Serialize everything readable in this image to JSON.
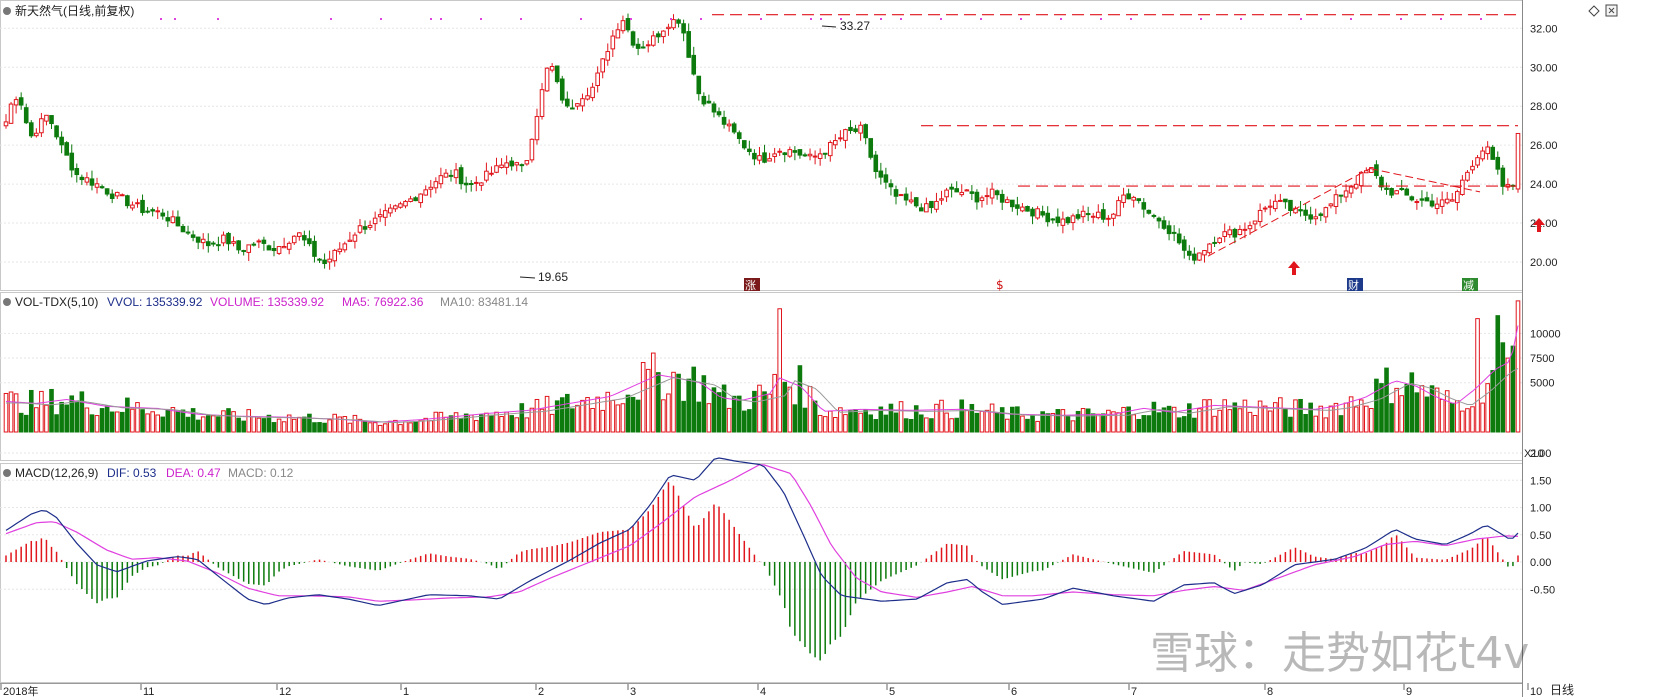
{
  "header": {
    "main_title": "新天然气(日线,前复权)",
    "vol_title": "VOL-TDX(5,10)",
    "vol_vvol": "VVOL: 135339.92",
    "vol_volume": "VOLUME: 135339.92",
    "vol_ma5": "MA5: 76922.36",
    "vol_ma10": "MA10: 83481.14",
    "macd_title": "MACD(12,26,9)",
    "macd_dif": "DIF: 0.53",
    "macd_dea": "DEA: 0.47",
    "macd_macd": "MACD: 0.12"
  },
  "markers": {
    "high_label": "33.27",
    "low_label": "19.65",
    "event_1": "涨",
    "event_2": "$",
    "event_3": "财",
    "event_4": "减"
  },
  "x_axis": {
    "months": [
      "2018年",
      "11",
      "12",
      "1",
      "2",
      "3",
      "4",
      "5",
      "6",
      "7",
      "8",
      "9",
      "10"
    ],
    "period_label": "日线"
  },
  "watermark": "雪球：走势如花t4v",
  "vol_unit": "X10",
  "colors": {
    "up": "#e0161c",
    "down": "#0c7a0c",
    "ma_pink": "#e040e0",
    "ma_gray": "#999999",
    "dif": "#1d2e8a",
    "dea": "#e040e0",
    "support_line": "#e0161c"
  },
  "chart_data": [
    {
      "type": "candlestick",
      "title": "新天然气(日线,前复权)",
      "y_ticks": [
        20.0,
        22.0,
        24.0,
        26.0,
        28.0,
        30.0,
        32.0
      ],
      "ylim": [
        19.0,
        33.7
      ],
      "x_months": [
        "2018年",
        "11",
        "12",
        "1",
        "2",
        "3",
        "4",
        "5",
        "6",
        "7",
        "8",
        "9",
        "10"
      ],
      "annotations": [
        {
          "label": "33.27",
          "value": 33.27
        },
        {
          "label": "19.65",
          "value": 19.65
        }
      ],
      "horizontal_lines": [
        32.7,
        27.0,
        23.9
      ],
      "anchors": [
        [
          0,
          27.2
        ],
        [
          8,
          28.6
        ],
        [
          14,
          28.4
        ],
        [
          24,
          26.4
        ],
        [
          40,
          27.5
        ],
        [
          46,
          27.1
        ],
        [
          55,
          25.9
        ],
        [
          70,
          24.5
        ],
        [
          90,
          24.0
        ],
        [
          105,
          23.5
        ],
        [
          120,
          23.1
        ],
        [
          135,
          22.7
        ],
        [
          155,
          22.5
        ],
        [
          178,
          21.6
        ],
        [
          200,
          20.9
        ],
        [
          218,
          21.2
        ],
        [
          232,
          20.6
        ],
        [
          248,
          21.0
        ],
        [
          268,
          20.7
        ],
        [
          290,
          21.5
        ],
        [
          306,
          20.4
        ],
        [
          316,
          19.9
        ],
        [
          330,
          20.6
        ],
        [
          350,
          21.7
        ],
        [
          370,
          22.2
        ],
        [
          390,
          22.8
        ],
        [
          410,
          23.5
        ],
        [
          430,
          24.3
        ],
        [
          445,
          24.6
        ],
        [
          460,
          23.9
        ],
        [
          480,
          24.5
        ],
        [
          500,
          25.2
        ],
        [
          515,
          24.7
        ],
        [
          520,
          26.0
        ],
        [
          530,
          28.2
        ],
        [
          540,
          30.4
        ],
        [
          548,
          29.0
        ],
        [
          558,
          27.8
        ],
        [
          570,
          28.5
        ],
        [
          584,
          29.0
        ],
        [
          600,
          31.3
        ],
        [
          612,
          32.6
        ],
        [
          626,
          31.0
        ],
        [
          640,
          31.3
        ],
        [
          658,
          32.3
        ],
        [
          670,
          32.5
        ],
        [
          680,
          30.3
        ],
        [
          688,
          28.7
        ],
        [
          702,
          27.8
        ],
        [
          716,
          27.0
        ],
        [
          733,
          26.0
        ],
        [
          750,
          25.2
        ],
        [
          766,
          25.8
        ],
        [
          782,
          25.7
        ],
        [
          800,
          25.3
        ],
        [
          818,
          25.9
        ],
        [
          834,
          26.6
        ],
        [
          850,
          26.8
        ],
        [
          865,
          24.5
        ],
        [
          885,
          23.3
        ],
        [
          905,
          22.9
        ],
        [
          918,
          22.7
        ],
        [
          935,
          23.6
        ],
        [
          950,
          23.6
        ],
        [
          965,
          23.3
        ],
        [
          980,
          23.5
        ],
        [
          995,
          23.1
        ],
        [
          1015,
          22.7
        ],
        [
          1035,
          22.3
        ],
        [
          1052,
          22.1
        ],
        [
          1068,
          22.4
        ],
        [
          1084,
          22.4
        ],
        [
          1098,
          22.3
        ],
        [
          1110,
          23.4
        ],
        [
          1120,
          23.5
        ],
        [
          1134,
          22.6
        ],
        [
          1148,
          22.1
        ],
        [
          1162,
          21.3
        ],
        [
          1176,
          20.1
        ],
        [
          1190,
          20.7
        ],
        [
          1204,
          21.4
        ],
        [
          1220,
          21.5
        ],
        [
          1235,
          21.9
        ],
        [
          1247,
          22.6
        ],
        [
          1258,
          23.1
        ],
        [
          1270,
          22.9
        ],
        [
          1282,
          22.5
        ],
        [
          1298,
          22.4
        ],
        [
          1312,
          22.7
        ],
        [
          1326,
          23.5
        ],
        [
          1340,
          24.1
        ],
        [
          1355,
          24.8
        ],
        [
          1370,
          23.7
        ],
        [
          1386,
          23.5
        ],
        [
          1400,
          23.2
        ],
        [
          1412,
          23.1
        ],
        [
          1425,
          23.0
        ],
        [
          1438,
          23.2
        ],
        [
          1450,
          24.5
        ],
        [
          1461,
          25.5
        ],
        [
          1470,
          25.9
        ],
        [
          1480,
          24.8
        ],
        [
          1487,
          23.9
        ],
        [
          1492,
          23.8
        ],
        [
          1500,
          24.0
        ],
        [
          1502,
          26.6
        ]
      ]
    },
    {
      "type": "bar",
      "title": "VOL-TDX(5,10)",
      "y_ticks": [
        5000,
        7500,
        10000
      ],
      "ylim": [
        0,
        14000
      ],
      "unit": "X10",
      "series": [
        {
          "name": "MA5",
          "values_note": "moving average of volume"
        },
        {
          "name": "MA10",
          "values_note": "moving average of volume"
        }
      ],
      "anchors": [
        [
          0,
          3100
        ],
        [
          30,
          2900
        ],
        [
          60,
          3300
        ],
        [
          100,
          2600
        ],
        [
          150,
          2400
        ],
        [
          190,
          1800
        ],
        [
          230,
          1600
        ],
        [
          280,
          1500
        ],
        [
          330,
          1300
        ],
        [
          370,
          1000
        ],
        [
          405,
          1200
        ],
        [
          440,
          1500
        ],
        [
          480,
          1900
        ],
        [
          520,
          2200
        ],
        [
          560,
          2900
        ],
        [
          600,
          3600
        ],
        [
          635,
          5200
        ],
        [
          648,
          5800
        ],
        [
          665,
          5500
        ],
        [
          690,
          5000
        ],
        [
          710,
          3500
        ],
        [
          730,
          3200
        ],
        [
          760,
          3900
        ],
        [
          768,
          5500
        ],
        [
          790,
          4600
        ],
        [
          812,
          2100
        ],
        [
          850,
          2300
        ],
        [
          900,
          2200
        ],
        [
          950,
          2300
        ],
        [
          1000,
          1800
        ],
        [
          1050,
          1700
        ],
        [
          1100,
          1800
        ],
        [
          1130,
          2400
        ],
        [
          1160,
          2000
        ],
        [
          1200,
          2700
        ],
        [
          1250,
          2500
        ],
        [
          1300,
          2300
        ],
        [
          1320,
          2600
        ],
        [
          1350,
          3500
        ],
        [
          1380,
          5200
        ],
        [
          1400,
          4700
        ],
        [
          1420,
          3600
        ],
        [
          1440,
          2800
        ],
        [
          1460,
          4400
        ],
        [
          1480,
          6400
        ],
        [
          1495,
          7200
        ],
        [
          1502,
          10800
        ]
      ]
    },
    {
      "type": "line",
      "title": "MACD(12,26,9)",
      "y_ticks": [
        -0.5,
        0.0,
        0.5,
        1.0,
        1.5,
        2.0
      ],
      "ylim": [
        -0.95,
        2.25
      ],
      "series": [
        {
          "name": "DIF",
          "anchors": [
            [
              0,
              0.58
            ],
            [
              25,
              0.88
            ],
            [
              38,
              0.96
            ],
            [
              50,
              0.82
            ],
            [
              70,
              0.35
            ],
            [
              90,
              -0.05
            ],
            [
              110,
              -0.18
            ],
            [
              140,
              0.02
            ],
            [
              170,
              0.1
            ],
            [
              190,
              0.05
            ],
            [
              215,
              -0.32
            ],
            [
              240,
              -0.68
            ],
            [
              258,
              -0.78
            ],
            [
              280,
              -0.66
            ],
            [
              310,
              -0.6
            ],
            [
              340,
              -0.68
            ],
            [
              370,
              -0.8
            ],
            [
              390,
              -0.72
            ],
            [
              420,
              -0.6
            ],
            [
              460,
              -0.62
            ],
            [
              490,
              -0.68
            ],
            [
              520,
              -0.35
            ],
            [
              560,
              0.03
            ],
            [
              590,
              0.35
            ],
            [
              620,
              0.6
            ],
            [
              640,
              1.05
            ],
            [
              660,
              1.6
            ],
            [
              685,
              1.5
            ],
            [
              705,
              1.92
            ],
            [
              725,
              1.85
            ],
            [
              752,
              1.78
            ],
            [
              772,
              1.3
            ],
            [
              792,
              0.5
            ],
            [
              810,
              -0.25
            ],
            [
              830,
              -0.62
            ],
            [
              870,
              -0.72
            ],
            [
              905,
              -0.68
            ],
            [
              935,
              -0.38
            ],
            [
              955,
              -0.32
            ],
            [
              970,
              -0.55
            ],
            [
              990,
              -0.78
            ],
            [
              1030,
              -0.68
            ],
            [
              1060,
              -0.48
            ],
            [
              1100,
              -0.62
            ],
            [
              1140,
              -0.72
            ],
            [
              1170,
              -0.42
            ],
            [
              1200,
              -0.38
            ],
            [
              1220,
              -0.58
            ],
            [
              1248,
              -0.42
            ],
            [
              1280,
              -0.05
            ],
            [
              1320,
              0.05
            ],
            [
              1350,
              0.25
            ],
            [
              1380,
              0.6
            ],
            [
              1400,
              0.42
            ],
            [
              1430,
              0.32
            ],
            [
              1455,
              0.52
            ],
            [
              1470,
              0.68
            ],
            [
              1485,
              0.52
            ],
            [
              1495,
              0.4
            ],
            [
              1502,
              0.53
            ]
          ]
        },
        {
          "name": "DEA",
          "anchors": [
            [
              0,
              0.52
            ],
            [
              30,
              0.72
            ],
            [
              48,
              0.74
            ],
            [
              70,
              0.55
            ],
            [
              100,
              0.22
            ],
            [
              125,
              0.05
            ],
            [
              150,
              0.08
            ],
            [
              180,
              0.02
            ],
            [
              210,
              -0.2
            ],
            [
              240,
              -0.48
            ],
            [
              270,
              -0.62
            ],
            [
              300,
              -0.62
            ],
            [
              340,
              -0.64
            ],
            [
              370,
              -0.72
            ],
            [
              400,
              -0.7
            ],
            [
              440,
              -0.66
            ],
            [
              480,
              -0.64
            ],
            [
              510,
              -0.55
            ],
            [
              540,
              -0.3
            ],
            [
              580,
              0.0
            ],
            [
              620,
              0.3
            ],
            [
              650,
              0.7
            ],
            [
              685,
              1.2
            ],
            [
              720,
              1.5
            ],
            [
              750,
              1.8
            ],
            [
              780,
              1.62
            ],
            [
              800,
              1.02
            ],
            [
              820,
              0.3
            ],
            [
              845,
              -0.3
            ],
            [
              870,
              -0.55
            ],
            [
              905,
              -0.65
            ],
            [
              935,
              -0.55
            ],
            [
              960,
              -0.45
            ],
            [
              990,
              -0.62
            ],
            [
              1020,
              -0.62
            ],
            [
              1060,
              -0.55
            ],
            [
              1100,
              -0.6
            ],
            [
              1140,
              -0.62
            ],
            [
              1170,
              -0.52
            ],
            [
              1200,
              -0.45
            ],
            [
              1230,
              -0.52
            ],
            [
              1260,
              -0.32
            ],
            [
              1300,
              -0.05
            ],
            [
              1340,
              0.1
            ],
            [
              1370,
              0.32
            ],
            [
              1400,
              0.38
            ],
            [
              1430,
              0.3
            ],
            [
              1460,
              0.42
            ],
            [
              1490,
              0.48
            ],
            [
              1502,
              0.47
            ]
          ]
        }
      ]
    }
  ]
}
